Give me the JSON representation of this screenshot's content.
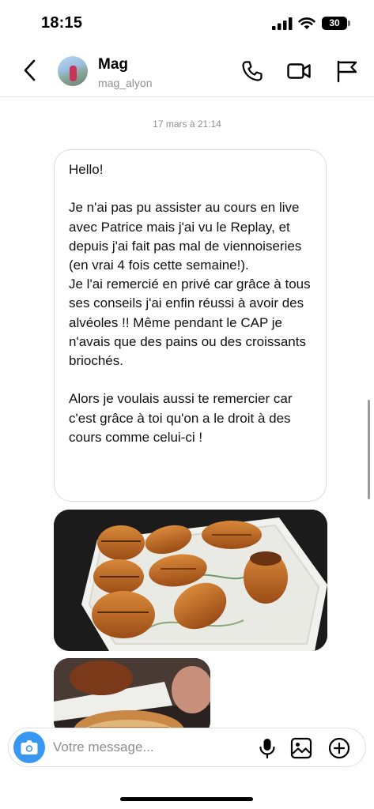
{
  "status_bar": {
    "time": "18:15",
    "battery": "30"
  },
  "header": {
    "name": "Mag",
    "handle": "mag_alyon"
  },
  "conversation": {
    "timestamp": "17 mars à 21:14",
    "message": "Hello!\n\nJe n'ai pas pu assister au cours en live avec Patrice mais j'ai vu le Replay, et depuis j'ai fait pas mal de viennoiseries (en vrai 4 fois cette semaine!).\nJe l'ai remercié en privé car grâce à tous ses conseils j'ai enfin réussi à avoir des alvéoles !! Même pendant le CAP je n'avais que des pains ou des croissants briochés.\n\nAlors je voulais aussi te remercier car c'est grâce à toi qu'on a le droit à des cours comme celui-ci !"
  },
  "composer": {
    "placeholder": "Votre message..."
  },
  "icons": {
    "back": "chevron-left-icon",
    "call": "phone-icon",
    "video": "video-camera-icon",
    "report": "flag-icon",
    "camera": "camera-icon",
    "mic": "microphone-icon",
    "gallery": "image-icon",
    "more": "plus-circle-icon"
  },
  "colors": {
    "accent": "#3897f0",
    "secondary_text": "#8e8e8e",
    "border": "#dbdbdb"
  }
}
